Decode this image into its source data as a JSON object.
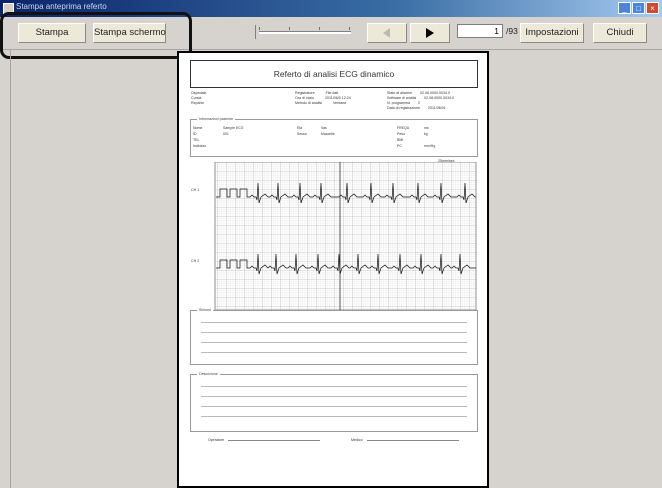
{
  "window": {
    "title": "Stampa anteprima referto"
  },
  "toolbar": {
    "print_label": "Stampa",
    "print_screen_label": "Stampa schermo",
    "page_current": "1",
    "page_total": "/93",
    "settings_label": "Impostazioni",
    "close_label": "Chiudi"
  },
  "report": {
    "title": "Referto di analisi ECG dinamico",
    "info_col1": [
      "Ospedale",
      "Corsia",
      "Reparto"
    ],
    "info_col2": [
      "Registratore",
      "Ora di inizio",
      "Metodo di analisi"
    ],
    "info_col2_values": [
      "File dati",
      "2011/06/0 12:24",
      "Ventana"
    ],
    "info_col3": [
      "Stato di allarme",
      "Software di analisi",
      "N. programma",
      "Data di registrazione"
    ],
    "info_col3_values": [
      "02.08.0000.0034.0",
      "02.08.0000.0034.0",
      "2",
      "2011/06/01"
    ],
    "patient_section": "Informazioni paziente",
    "patient_rows": [
      [
        "Nome",
        "Sample ECG",
        "Età",
        "Vas",
        "FREQU",
        "ms"
      ],
      [
        "ID",
        "001",
        "Sesso",
        "Maschile",
        "Peso",
        "kg"
      ],
      [
        "TEL",
        "",
        "",
        "",
        "BMI",
        ""
      ],
      [
        "Indirizzo",
        "",
        "",
        "",
        "PC",
        "mm/Hg"
      ]
    ],
    "scale_label": "25mm/sec",
    "ch1_label": "CH 1",
    "ch2_label": "CH 2",
    "symptoms_label": "Sintomi",
    "description_label": "Descrizione",
    "operator_label": "Operatore",
    "doctor_label": "Medico"
  }
}
